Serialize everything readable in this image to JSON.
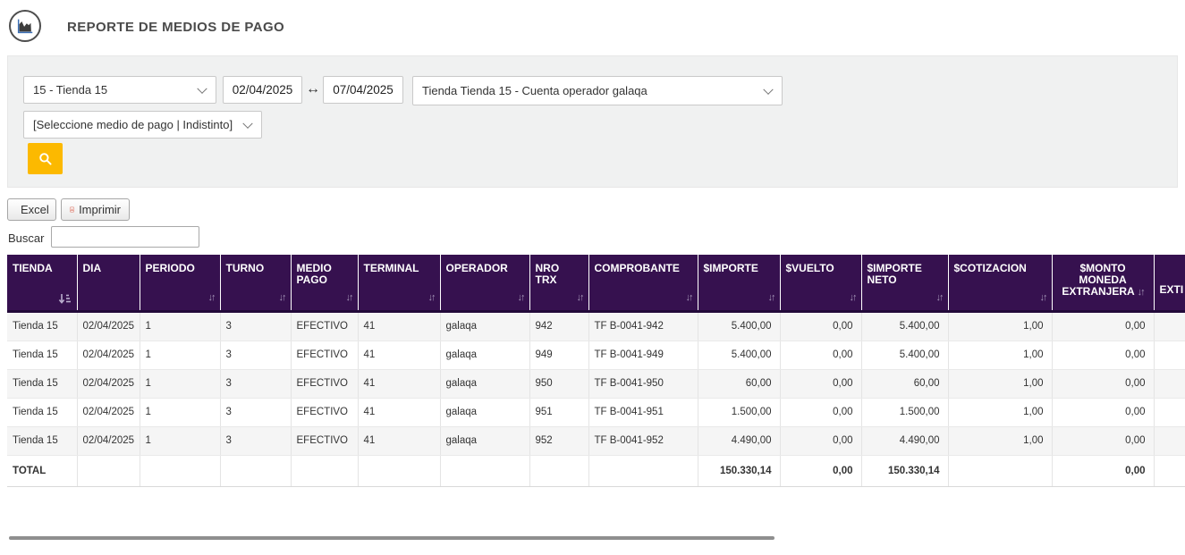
{
  "header": {
    "title": "REPORTE DE MEDIOS DE PAGO"
  },
  "filters": {
    "store_select_value": "15 - Tienda 15",
    "date_from": "02/04/2025",
    "date_to": "07/04/2025",
    "date_arrow": "↔",
    "account_select_value": "Tienda Tienda 15 - Cuenta operador galaqa",
    "payment_select_value": "[Seleccione medio de pago | Indistinto]"
  },
  "toolbar": {
    "excel_label": "Excel",
    "imprimir_label": "Imprimir",
    "buscar_label": "Buscar",
    "buscar_value": ""
  },
  "icons": {
    "sort_both_icon": "↓↑"
  },
  "table": {
    "columns": [
      {
        "label": "TIENDA",
        "sort": "asc",
        "align": "left"
      },
      {
        "label": "DIA",
        "sort": "none",
        "align": "left"
      },
      {
        "label": "PERIODO",
        "sort": "both",
        "align": "left"
      },
      {
        "label": "TURNO",
        "sort": "both",
        "align": "left"
      },
      {
        "label": "MEDIO PAGO",
        "sort": "both",
        "align": "left"
      },
      {
        "label": "TERMINAL",
        "sort": "both",
        "align": "left"
      },
      {
        "label": "OPERADOR",
        "sort": "both",
        "align": "left"
      },
      {
        "label": "NRO TRX",
        "sort": "both",
        "align": "left"
      },
      {
        "label": "COMPROBANTE",
        "sort": "both",
        "align": "left"
      },
      {
        "label": "$IMPORTE",
        "sort": "both",
        "align": "right"
      },
      {
        "label": "$VUELTO",
        "sort": "both",
        "align": "right"
      },
      {
        "label": "$IMPORTE NETO",
        "sort": "both",
        "align": "right"
      },
      {
        "label": "$COTIZACION",
        "sort": "both",
        "align": "right"
      },
      {
        "label": "$MONTO MONEDA EXTRANJERA",
        "sort": "both",
        "align": "right",
        "header_align": "center"
      },
      {
        "label": "EXTI",
        "sort": "none",
        "align": "left",
        "header_valign": "bottom"
      }
    ],
    "rows": [
      [
        "Tienda 15",
        "02/04/2025",
        "1",
        "3",
        "EFECTIVO",
        "41",
        "galaqa",
        "942",
        "TF B-0041-942",
        "5.400,00",
        "0,00",
        "5.400,00",
        "1,00",
        "0,00",
        ""
      ],
      [
        "Tienda 15",
        "02/04/2025",
        "1",
        "3",
        "EFECTIVO",
        "41",
        "galaqa",
        "949",
        "TF B-0041-949",
        "5.400,00",
        "0,00",
        "5.400,00",
        "1,00",
        "0,00",
        ""
      ],
      [
        "Tienda 15",
        "02/04/2025",
        "1",
        "3",
        "EFECTIVO",
        "41",
        "galaqa",
        "950",
        "TF B-0041-950",
        "60,00",
        "0,00",
        "60,00",
        "1,00",
        "0,00",
        ""
      ],
      [
        "Tienda 15",
        "02/04/2025",
        "1",
        "3",
        "EFECTIVO",
        "41",
        "galaqa",
        "951",
        "TF B-0041-951",
        "1.500,00",
        "0,00",
        "1.500,00",
        "1,00",
        "0,00",
        ""
      ],
      [
        "Tienda 15",
        "02/04/2025",
        "1",
        "3",
        "EFECTIVO",
        "41",
        "galaqa",
        "952",
        "TF B-0041-952",
        "4.490,00",
        "0,00",
        "4.490,00",
        "1,00",
        "0,00",
        ""
      ]
    ],
    "total_row": [
      "TOTAL",
      "",
      "",
      "",
      "",
      "",
      "",
      "",
      "",
      "150.330,14",
      "0,00",
      "150.330,14",
      "",
      "0,00",
      ""
    ]
  },
  "colors": {
    "header_purple": "#36114f",
    "search_button_amber": "#fcb900",
    "row_stripe": "#f5f5f5",
    "panel_gray": "#f0f1f1",
    "excel_green": "#1e7245",
    "pdf_red": "#cc4b37"
  }
}
